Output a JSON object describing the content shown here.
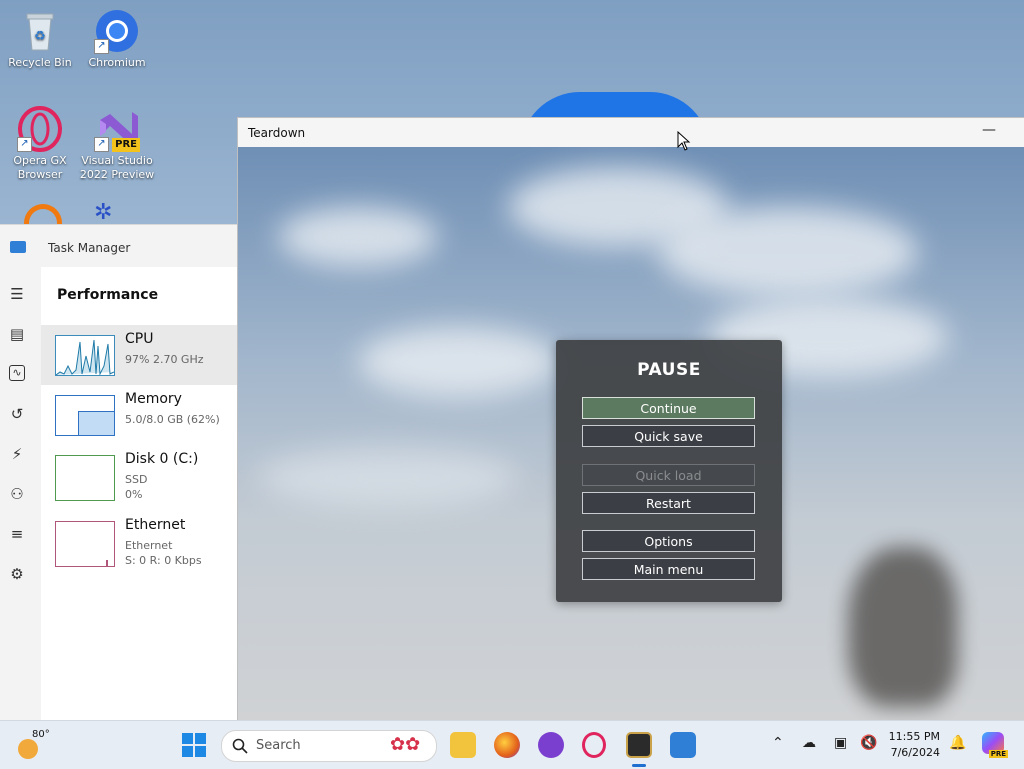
{
  "desktop": {
    "icons": [
      {
        "label": "Recycle Bin"
      },
      {
        "label": "Chromium"
      },
      {
        "label": "Opera GX Browser"
      },
      {
        "label": "Visual Studio 2022 Preview",
        "badge": "PRE"
      }
    ]
  },
  "task_manager": {
    "title": "Task Manager",
    "section": "Performance",
    "items": [
      {
        "name": "CPU",
        "line1": "97% 2.70 GHz",
        "line2": ""
      },
      {
        "name": "Memory",
        "line1": "5.0/8.0 GB (62%)",
        "line2": ""
      },
      {
        "name": "Disk 0 (C:)",
        "line1": "SSD",
        "line2": "0%"
      },
      {
        "name": "Ethernet",
        "line1": "Ethernet",
        "line2": "S: 0 R: 0 Kbps"
      }
    ]
  },
  "teardown": {
    "title": "Teardown",
    "minimize": "—",
    "pause_menu": {
      "title": "PAUSE",
      "buttons": [
        {
          "label": "Continue",
          "state": "active"
        },
        {
          "label": "Quick save",
          "state": "normal"
        },
        {
          "label": "Quick load",
          "state": "disabled"
        },
        {
          "label": "Restart",
          "state": "normal"
        },
        {
          "label": "Options",
          "state": "normal"
        },
        {
          "label": "Main menu",
          "state": "normal"
        }
      ]
    }
  },
  "taskbar": {
    "weather": "80°",
    "search_label": "Search",
    "time": "11:55 PM",
    "date": "7/6/2024",
    "copilot_badge": "PRE"
  }
}
